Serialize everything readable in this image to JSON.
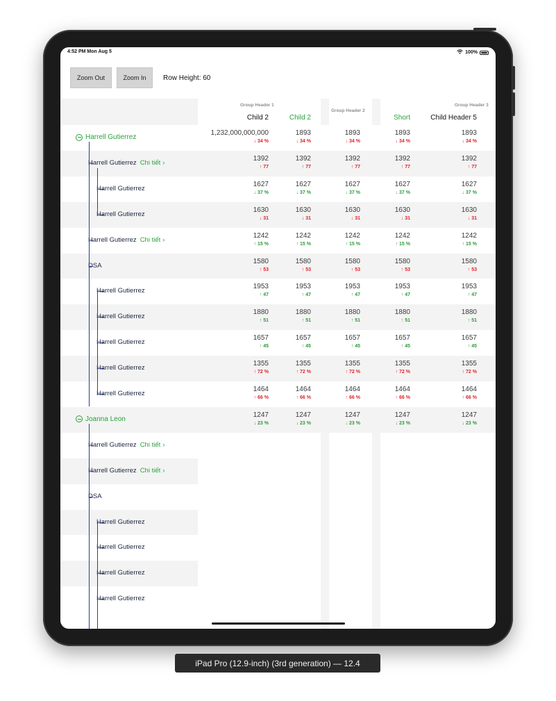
{
  "status_bar": {
    "time_date": "4:52 PM   Mon Aug 5",
    "battery": "100%"
  },
  "toolbar": {
    "zoom_out": "Zoom Out",
    "zoom_in": "Zoom In",
    "row_height": "Row Height: 60"
  },
  "headers": {
    "group1": "Group Header 1",
    "group2": "Group Header 2",
    "group3": "Group Header 3",
    "child_a": "Child 2",
    "child_b": "Child 2",
    "short": "Short",
    "child5": "Child Header 5"
  },
  "colors": {
    "accent_green": "#27a33a",
    "down_red": "#e0242c",
    "up_green": "#2e9b3a",
    "tree_line": "#2b3d8c"
  },
  "tree_rows": [
    {
      "label": "Harrell Gutierrez",
      "type": "group",
      "level": 0
    },
    {
      "label": "Harrell Gutierrez",
      "type": "item",
      "level": 1,
      "detail": "Chi tiết"
    },
    {
      "label": "Harrell Gutierrez",
      "type": "item",
      "level": 2
    },
    {
      "label": "Harrell Gutierrez",
      "type": "item",
      "level": 2
    },
    {
      "label": "Harrell Gutierrez",
      "type": "item",
      "level": 1,
      "detail": "Chi tiết"
    },
    {
      "label": "DSA",
      "type": "item",
      "level": 1
    },
    {
      "label": "Harrell Gutierrez",
      "type": "item",
      "level": 2
    },
    {
      "label": "Harrell Gutierrez",
      "type": "item",
      "level": 2
    },
    {
      "label": "Harrell Gutierrez",
      "type": "item",
      "level": 2
    },
    {
      "label": "Harrell Gutierrez",
      "type": "item",
      "level": 2
    },
    {
      "label": "Harrell Gutierrez",
      "type": "item",
      "level": 2
    },
    {
      "label": "Joanna Leon",
      "type": "group",
      "level": 0
    },
    {
      "label": "Harrell Gutierrez",
      "type": "item",
      "level": 1,
      "detail": "Chi tiết"
    },
    {
      "label": "Harrell Gutierrez",
      "type": "item",
      "level": 1,
      "detail": "Chi tiết"
    },
    {
      "label": "DSA",
      "type": "item",
      "level": 1
    },
    {
      "label": "Harrell Gutierrez",
      "type": "item",
      "level": 2
    },
    {
      "label": "Harrell Gutierrez",
      "type": "item",
      "level": 2
    },
    {
      "label": "Harrell Gutierrez",
      "type": "item",
      "level": 2
    },
    {
      "label": "Harrell Gutierrez",
      "type": "item",
      "level": 2
    }
  ],
  "data_rows": [
    {
      "values": [
        "1,232,000,000,000",
        "1893",
        "1893",
        "1893",
        "1893"
      ],
      "delta": "↓ 34 %",
      "dir": "down"
    },
    {
      "values": [
        "1392",
        "1392",
        "1392",
        "1392",
        "1392"
      ],
      "delta": "↑ 77",
      "dir": "down"
    },
    {
      "values": [
        "1627",
        "1627",
        "1627",
        "1627",
        "1627"
      ],
      "delta": "↓ 37 %",
      "dir": "up"
    },
    {
      "values": [
        "1630",
        "1630",
        "1630",
        "1630",
        "1630"
      ],
      "delta": "↓ 31",
      "dir": "down"
    },
    {
      "values": [
        "1242",
        "1242",
        "1242",
        "1242",
        "1242"
      ],
      "delta": "↑ 15 %",
      "dir": "up"
    },
    {
      "values": [
        "1580",
        "1580",
        "1580",
        "1580",
        "1580"
      ],
      "delta": "↑ 53",
      "dir": "down"
    },
    {
      "values": [
        "1953",
        "1953",
        "1953",
        "1953",
        "1953"
      ],
      "delta": "↑ 47",
      "dir": "up"
    },
    {
      "values": [
        "1880",
        "1880",
        "1880",
        "1880",
        "1880"
      ],
      "delta": "↑ 51",
      "dir": "up"
    },
    {
      "values": [
        "1657",
        "1657",
        "1657",
        "1657",
        "1657"
      ],
      "delta": "↑ 45",
      "dir": "up"
    },
    {
      "values": [
        "1355",
        "1355",
        "1355",
        "1355",
        "1355"
      ],
      "delta": "↑ 72 %",
      "dir": "down"
    },
    {
      "values": [
        "1464",
        "1464",
        "1464",
        "1464",
        "1464"
      ],
      "delta": "↑ 66 %",
      "dir": "down"
    },
    {
      "values": [
        "1247",
        "1247",
        "1247",
        "1247",
        "1247"
      ],
      "delta": "↓ 23 %",
      "dir": "up"
    }
  ],
  "device_label": "iPad Pro (12.9-inch) (3rd generation) — 12.4"
}
